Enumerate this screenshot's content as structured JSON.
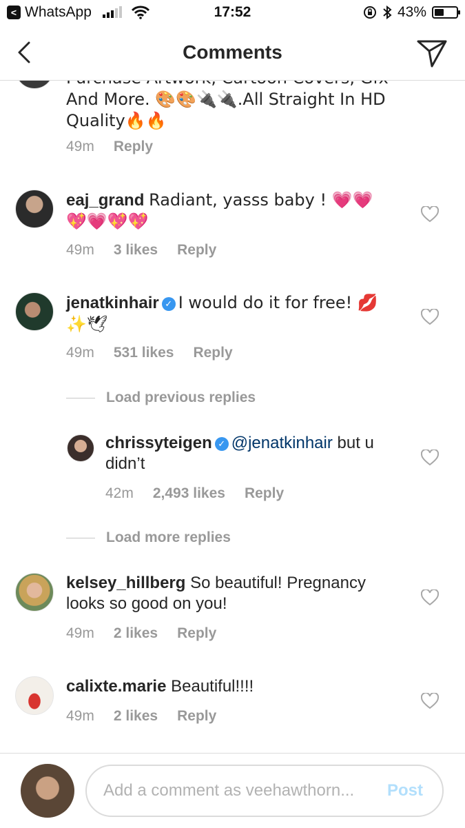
{
  "status_bar": {
    "back_app": "WhatsApp",
    "time": "17:52",
    "battery": "43%",
    "battery_level": 0.43
  },
  "nav": {
    "title": "Comments",
    "back_icon": "chevron-left-icon",
    "send_icon": "paper-plane-icon"
  },
  "comments": [
    {
      "username": "",
      "text": "Purchase Artwork, Cartoon Covers, Gfx And More. 🎨🎨🔌🔌.All Straight In HD Quality🔥🔥",
      "time": "49m",
      "likes": "",
      "reply": "Reply"
    },
    {
      "username": "eaj_grand",
      "text": "Radiant,  yasss baby ! 💗💗💖💗💖💖",
      "time": "49m",
      "likes": "3 likes",
      "reply": "Reply"
    },
    {
      "username": "jenatkinhair",
      "verified": true,
      "text": "I would do it for free! 💋✨🕊",
      "time": "49m",
      "likes": "531 likes",
      "reply": "Reply"
    }
  ],
  "load_previous": "Load previous replies",
  "reply_comment": {
    "username": "chrissyteigen",
    "verified": true,
    "mention": "@jenatkinhair",
    "text": "but u didn’t",
    "time": "42m",
    "likes": "2,493 likes",
    "reply": "Reply"
  },
  "load_more": "Load more replies",
  "comments_after": [
    {
      "username": "kelsey_hillberg",
      "text": "So beautiful!  Pregnancy looks so good on you!",
      "time": "49m",
      "likes": "2 likes",
      "reply": "Reply"
    },
    {
      "username": "calixte.marie",
      "text": "Beautiful!!!!",
      "time": "49m",
      "likes": "2 likes",
      "reply": "Reply"
    }
  ],
  "composer": {
    "placeholder": "Add a comment as veehawthorn...",
    "post_label": "Post"
  },
  "colors": {
    "verified": "#3897f0",
    "meta_gray": "#999999",
    "post_disabled": "#b2dffc",
    "mention": "#003569"
  }
}
